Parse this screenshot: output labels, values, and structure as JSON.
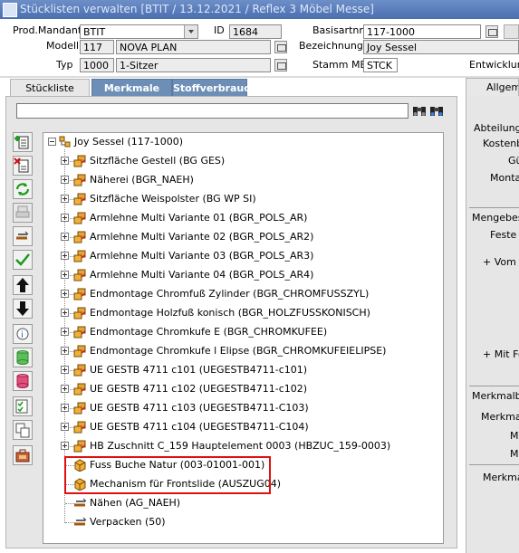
{
  "window": {
    "title": "Stücklisten verwalten   [BTIT / 13.12.2021 / Reflex 3 Möbel Messe]"
  },
  "header": {
    "prod_mandant_label": "Prod.Mandant",
    "prod_mandant_value": "BTIT",
    "id_label": "ID",
    "id_value": "1684",
    "basisartnr_label": "Basisartnr",
    "basisartnr_value": "117-1000",
    "modell_label": "Modell",
    "modell_code": "117",
    "modell_name": "NOVA PLAN",
    "bezeichnung_label": "Bezeichnung",
    "bezeichnung_value": "Joy Sessel",
    "typ_label": "Typ",
    "typ_code": "1000",
    "typ_name": "1-Sitzer",
    "stamm_me_label": "Stamm ME",
    "stamm_me_value": "STCK",
    "entwicklung_label": "Entwicklung"
  },
  "tabs": [
    {
      "label": "Stückliste",
      "active": true
    },
    {
      "label": "Merkmale",
      "active": false
    },
    {
      "label": "Stoffverbrauch",
      "active": false
    }
  ],
  "search": {
    "value": ""
  },
  "toolbar_icons": [
    "add-document-icon",
    "delete-document-icon",
    "refresh-icon",
    "print-icon",
    "edit-icon",
    "check-icon",
    "arrow-up-icon",
    "arrow-down-icon",
    "info-icon",
    "database-green-icon",
    "database-red-icon",
    "checklist-icon",
    "copy-icon",
    "toolbox-icon"
  ],
  "tree": {
    "root": "Joy Sessel (117-1000)",
    "children": [
      {
        "label": "Sitzfläche Gestell (BG GES)",
        "type": "group",
        "expandable": true
      },
      {
        "label": "Näherei (BGR_NAEH)",
        "type": "group",
        "expandable": true
      },
      {
        "label": "Sitzfläche Weispolster (BG WP SI)",
        "type": "group",
        "expandable": true
      },
      {
        "label": "Armlehne Multi Variante 01 (BGR_POLS_AR)",
        "type": "group",
        "expandable": true
      },
      {
        "label": "Armlehne Multi Variante 02 (BGR_POLS_AR2)",
        "type": "group",
        "expandable": true
      },
      {
        "label": "Armlehne Multi Variante 03 (BGR_POLS_AR3)",
        "type": "group",
        "expandable": true
      },
      {
        "label": "Armlehne Multi Variante 04 (BGR_POLS_AR4)",
        "type": "group",
        "expandable": true
      },
      {
        "label": "Endmontage Chromfuß Zylinder (BGR_CHROMFUSSZYL)",
        "type": "group",
        "expandable": true
      },
      {
        "label": "Endmontage Holzfuß konisch (BGR_HOLZFUSSKONISCH)",
        "type": "group",
        "expandable": true
      },
      {
        "label": "Endmontage Chromkufe E (BGR_CHROMKUFEE)",
        "type": "group",
        "expandable": true
      },
      {
        "label": "Endmontage Chromkufe l Elipse (BGR_CHROMKUFEIELIPSE)",
        "type": "group",
        "expandable": true
      },
      {
        "label": "UE GESTB 4711 c101 (UEGESTB4711-c101)",
        "type": "group",
        "expandable": true
      },
      {
        "label": "UE GESTB 4711 c102 (UEGESTB4711-c102)",
        "type": "group",
        "expandable": true
      },
      {
        "label": "UE GESTB 4711 c103 (UEGESTB4711-C103)",
        "type": "group",
        "expandable": true
      },
      {
        "label": "UE GESTB 4711 c104 (UEGESTB4711-C104)",
        "type": "group",
        "expandable": true
      },
      {
        "label": "HB Zuschnitt C_159 Hauptelement 0003 (HBZUC_159-0003)",
        "type": "group",
        "expandable": true
      },
      {
        "label": "Fuss Buche Natur (003-01001-001)",
        "type": "part",
        "expandable": false
      },
      {
        "label": "Mechanism für Frontslide (AUSZUG04)",
        "type": "part",
        "expandable": false
      },
      {
        "label": "Nähen (AG_NAEH)",
        "type": "operation",
        "expandable": false
      },
      {
        "label": "Verpacken (50)",
        "type": "operation",
        "expandable": false
      }
    ]
  },
  "right_panel": {
    "tab_label": "Allgeme",
    "abteilung": "Abteilung",
    "kosten": "Kostenb",
    "gu": "Gü",
    "montag": "Montag",
    "mengebest": "Mengebest",
    "feste": "Feste",
    "vom": "+ Vom R",
    "mit_for": "+ Mit For",
    "merkmalbe": "Merkmalbe",
    "merkmal": "Merkmal",
    "m1": "M",
    "m2": "M",
    "merkmal2": "Merkmal"
  },
  "colors": {
    "titlebar": "#4a6fb0",
    "inactive_tab": "#6d8fb7",
    "highlight": "#e01010",
    "folder_orange": "#e8a23a",
    "box_orange": "#f0b13a"
  }
}
